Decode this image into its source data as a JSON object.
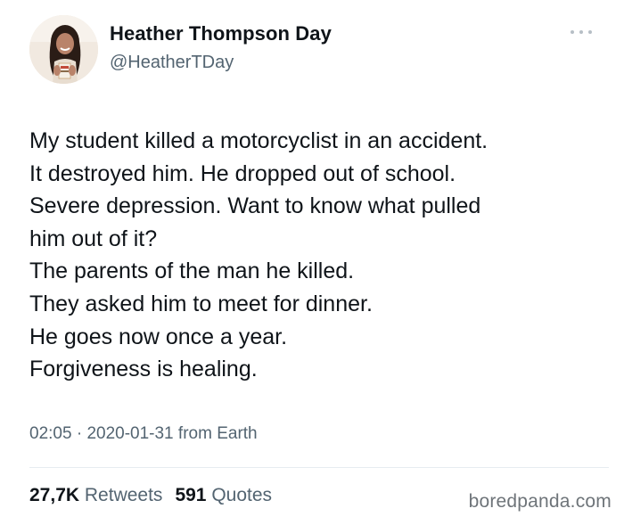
{
  "author": {
    "name": "Heather Thompson Day",
    "handle": "@HeatherTDay"
  },
  "menu_icon": "more-horizontal-icon",
  "tweet": {
    "lines": [
      "My student killed a motorcyclist in an accident.",
      "It destroyed him. He dropped out of school.",
      "Severe depression. Want to know what pulled",
      "him out of it?",
      "The parents of the man he killed.",
      "They asked him to meet for dinner.",
      "He goes now once a year.",
      "Forgiveness is healing."
    ]
  },
  "meta": {
    "time": "02:05",
    "separator": "·",
    "date": "2020-01-31",
    "source": "from Earth"
  },
  "stats": {
    "retweets_count": "27,7K",
    "retweets_label": "Retweets",
    "quotes_count": "591",
    "quotes_label": "Quotes"
  },
  "watermark": "boredpanda.com",
  "colors": {
    "text_primary": "#0f1419",
    "text_secondary": "#536471",
    "divider": "#e6ecf0"
  }
}
